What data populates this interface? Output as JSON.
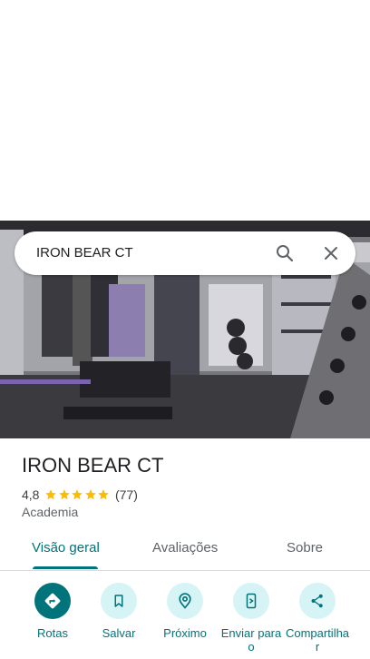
{
  "search": {
    "query": "IRON BEAR CT"
  },
  "place": {
    "name": "IRON BEAR CT",
    "rating": "4,8",
    "stars": 5,
    "reviews": "(77)",
    "category": "Academia"
  },
  "tabs": [
    {
      "label": "Visão geral",
      "active": true
    },
    {
      "label": "Avaliações",
      "active": false
    },
    {
      "label": "Sobre",
      "active": false
    }
  ],
  "actions": [
    {
      "label": "Rotas",
      "icon": "directions-icon"
    },
    {
      "label": "Salvar",
      "icon": "bookmark-icon"
    },
    {
      "label": "Próximo",
      "icon": "nearby-icon"
    },
    {
      "label": "Enviar para o",
      "icon": "send-to-phone-icon"
    },
    {
      "label": "Compartilhar",
      "icon": "share-icon"
    }
  ],
  "colors": {
    "accent": "#00747a",
    "accent_light": "#d6f3f5",
    "star": "#fbbc04"
  }
}
